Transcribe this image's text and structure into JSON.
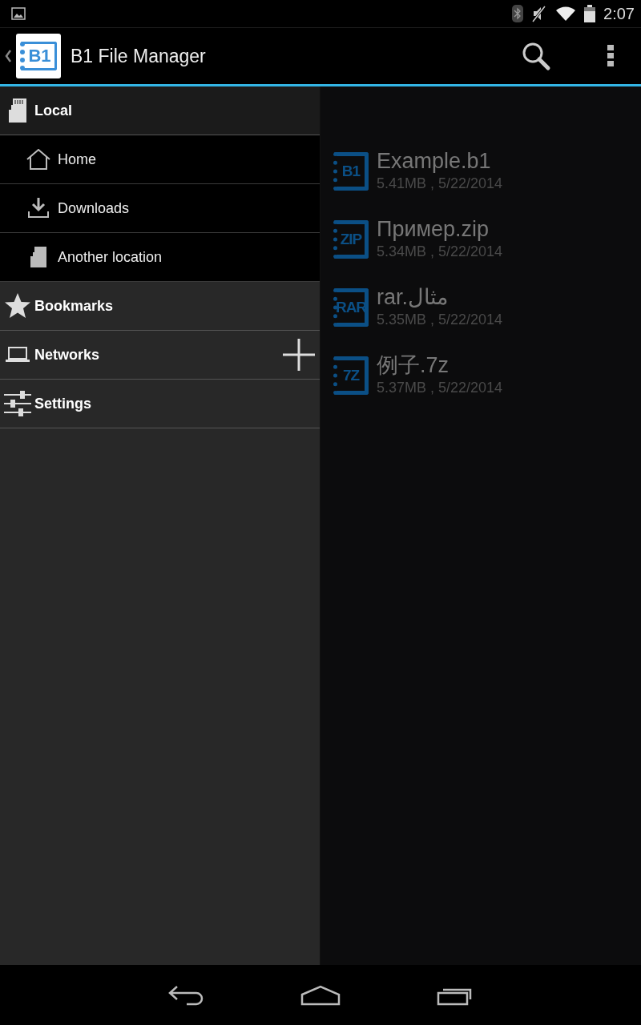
{
  "status_bar": {
    "time": "2:07"
  },
  "action_bar": {
    "logo_text": "B1",
    "title": "B1 File Manager"
  },
  "files_right": [
    {
      "badge": "B1",
      "name": "Example.b1",
      "meta": "5.41MB , 5/22/2014"
    },
    {
      "badge": "ZIP",
      "name": "Пример.zip",
      "meta": "5.34MB , 5/22/2014"
    },
    {
      "badge": "RAR",
      "name": "rar.مثال",
      "meta": "5.35MB , 5/22/2014"
    },
    {
      "badge": "7Z",
      "name": "例子.7z",
      "meta": "5.37MB , 5/22/2014"
    }
  ],
  "drawer": [
    {
      "kind": "sdcard",
      "label": "Local",
      "expanded": true,
      "children": [
        {
          "kind": "home",
          "label": "Home"
        },
        {
          "kind": "download",
          "label": "Downloads"
        },
        {
          "kind": "sdcard",
          "label": "Another location"
        }
      ]
    },
    {
      "kind": "star",
      "label": "Bookmarks",
      "expanded": false
    },
    {
      "kind": "laptop",
      "label": "Networks",
      "expanded": false,
      "add": true
    },
    {
      "kind": "sliders",
      "label": "Settings",
      "expanded": false
    }
  ]
}
